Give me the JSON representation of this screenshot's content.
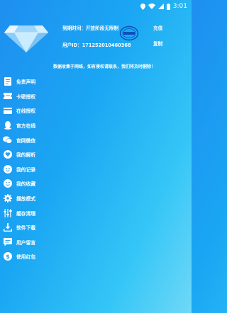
{
  "status_bar": {
    "time": "3:01"
  },
  "header": {
    "expiry_text": "到期时间：开放阶段无限制",
    "user_id_text": "用户ID：1712520104603​68",
    "recharge_label": "充值",
    "copy_label": "复制"
  },
  "notice": "数据收集于网络，如有侵权请联系，我们将及时删除！",
  "menu": [
    {
      "label": "免责声明",
      "icon": "document-icon"
    },
    {
      "label": "卡密授权",
      "icon": "ticket-icon"
    },
    {
      "label": "在线授权",
      "icon": "card-icon"
    },
    {
      "label": "官方在线",
      "icon": "qq-icon"
    },
    {
      "label": "官网微信",
      "icon": "wechat-icon"
    },
    {
      "label": "我的解析",
      "icon": "heart-icon"
    },
    {
      "label": "我的记录",
      "icon": "smile-icon"
    },
    {
      "label": "我的收藏",
      "icon": "face-icon"
    },
    {
      "label": "播放模式",
      "icon": "gear-icon"
    },
    {
      "label": "缓存清理",
      "icon": "sliders-icon"
    },
    {
      "label": "软件下载",
      "icon": "download-icon"
    },
    {
      "label": "用户留言",
      "icon": "message-icon"
    },
    {
      "label": "使用红包",
      "icon": "dollar-icon"
    }
  ]
}
